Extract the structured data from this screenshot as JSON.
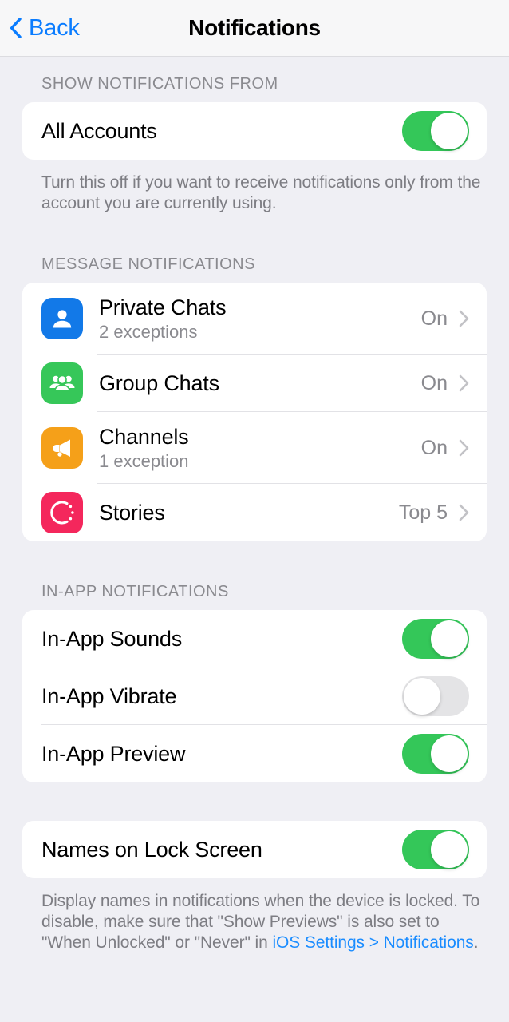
{
  "header": {
    "back_label": "Back",
    "title": "Notifications",
    "back_icon": "chevron-left-icon",
    "accent": "#0a7cff"
  },
  "sections": {
    "show_from": {
      "header": "SHOW NOTIFICATIONS FROM",
      "row": {
        "label": "All Accounts",
        "toggle": "on"
      },
      "footer": "Turn this off if you want to receive notifications only from the account you are currently using."
    },
    "message": {
      "header": "MESSAGE NOTIFICATIONS",
      "rows": [
        {
          "label": "Private Chats",
          "sub": "2 exceptions",
          "value": "On",
          "icon": "person-icon",
          "color": "#1279e8"
        },
        {
          "label": "Group Chats",
          "sub": "",
          "value": "On",
          "icon": "people-group-icon",
          "color": "#36c759"
        },
        {
          "label": "Channels",
          "sub": "1 exception",
          "value": "On",
          "icon": "megaphone-icon",
          "color": "#f5a019"
        },
        {
          "label": "Stories",
          "sub": "",
          "value": "Top 5",
          "icon": "stories-circle-icon",
          "color": "#f4275c"
        }
      ]
    },
    "in_app": {
      "header": "IN-APP NOTIFICATIONS",
      "rows": [
        {
          "label": "In-App Sounds",
          "toggle": "on"
        },
        {
          "label": "In-App Vibrate",
          "toggle": "off"
        },
        {
          "label": "In-App Preview",
          "toggle": "on"
        }
      ]
    },
    "lock_screen": {
      "row": {
        "label": "Names on Lock Screen",
        "toggle": "on"
      },
      "footer_prefix": "Display names in notifications when the device is locked. To disable, make sure that \"Show Previews\" is also set to \"When Unlocked\" or \"Never\" in ",
      "footer_link": "iOS Settings > Notifications",
      "footer_suffix": "."
    }
  }
}
